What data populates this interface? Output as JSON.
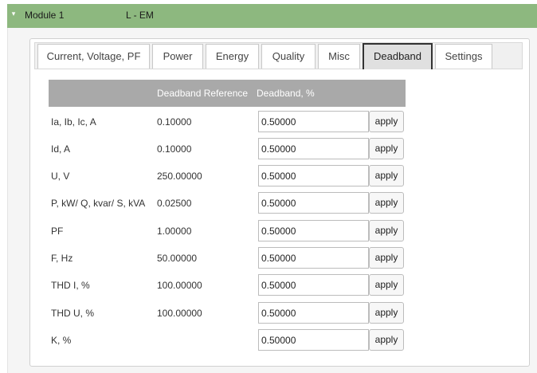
{
  "module": {
    "toggle_icon": "collapse-caret-icon",
    "name": "Module 1",
    "type": "L - EM"
  },
  "tabs": [
    {
      "label": "Current, Voltage, PF",
      "active": false
    },
    {
      "label": "Power",
      "active": false
    },
    {
      "label": "Energy",
      "active": false
    },
    {
      "label": "Quality",
      "active": false
    },
    {
      "label": "Misc",
      "active": false
    },
    {
      "label": "Deadband",
      "active": true
    },
    {
      "label": "Settings",
      "active": false
    }
  ],
  "table": {
    "headers": [
      "",
      "Deadband Reference",
      "Deadband, %"
    ],
    "apply_label": "apply",
    "rows": [
      {
        "label": "Ia, Ib, Ic, A",
        "reference": "0.10000",
        "deadband": "0.50000"
      },
      {
        "label": "Id, A",
        "reference": "0.10000",
        "deadband": "0.50000"
      },
      {
        "label": "U, V",
        "reference": "250.00000",
        "deadband": "0.50000"
      },
      {
        "label": "P, kW/ Q, kvar/ S, kVA",
        "reference": "0.02500",
        "deadband": "0.50000"
      },
      {
        "label": "PF",
        "reference": "1.00000",
        "deadband": "0.50000"
      },
      {
        "label": "F, Hz",
        "reference": "50.00000",
        "deadband": "0.50000"
      },
      {
        "label": "THD I, %",
        "reference": "100.00000",
        "deadband": "0.50000"
      },
      {
        "label": "THD U, %",
        "reference": "100.00000",
        "deadband": "0.50000"
      },
      {
        "label": "K, %",
        "reference": "",
        "deadband": "0.50000"
      }
    ]
  },
  "colors": {
    "module_header": "#8db87f",
    "table_header": "#a9a9a9",
    "active_tab": "#e0e0e0"
  }
}
